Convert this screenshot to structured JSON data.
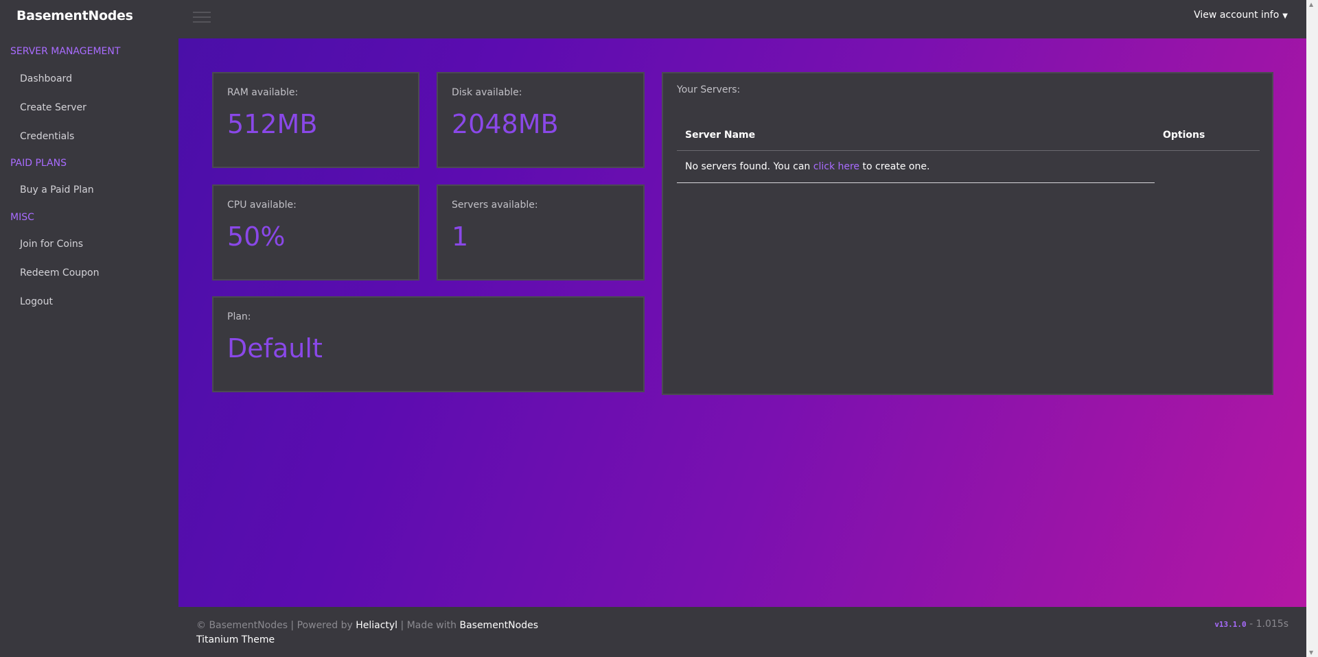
{
  "brand": "BasementNodes",
  "sidebar": {
    "sections": [
      {
        "title": "SERVER MANAGEMENT",
        "items": [
          "Dashboard",
          "Create Server",
          "Credentials"
        ]
      },
      {
        "title": "PAID PLANS",
        "items": [
          "Buy a Paid Plan"
        ]
      },
      {
        "title": "MISC",
        "items": [
          "Join for Coins",
          "Redeem Coupon",
          "Logout"
        ]
      }
    ]
  },
  "header": {
    "account_label": "View account info",
    "account_icon": "chevron-down-icon"
  },
  "stats": [
    {
      "label": "RAM available:",
      "value": "512MB"
    },
    {
      "label": "Disk available:",
      "value": "2048MB"
    },
    {
      "label": "CPU available:",
      "value": "50%"
    },
    {
      "label": "Servers available:",
      "value": "1"
    },
    {
      "label": "Plan:",
      "value": "Default"
    }
  ],
  "servers": {
    "title": "Your Servers:",
    "columns": [
      "Server Name",
      "Options"
    ],
    "empty_prefix": "No servers found. You can ",
    "empty_link": "click here",
    "empty_suffix": " to create one."
  },
  "footer": {
    "copyright": "© BasementNodes | Powered by ",
    "powered_by": "Heliactyl",
    "made_with_prefix": " | Made with ",
    "made_with": "BasementNodes",
    "theme": "Titanium Theme",
    "version": "v13.1.0",
    "load_time": " - 1.015s"
  },
  "colors": {
    "accent": "#a96cff",
    "value": "#8a48e8",
    "panel": "#3a393f",
    "background": "#39383e"
  }
}
